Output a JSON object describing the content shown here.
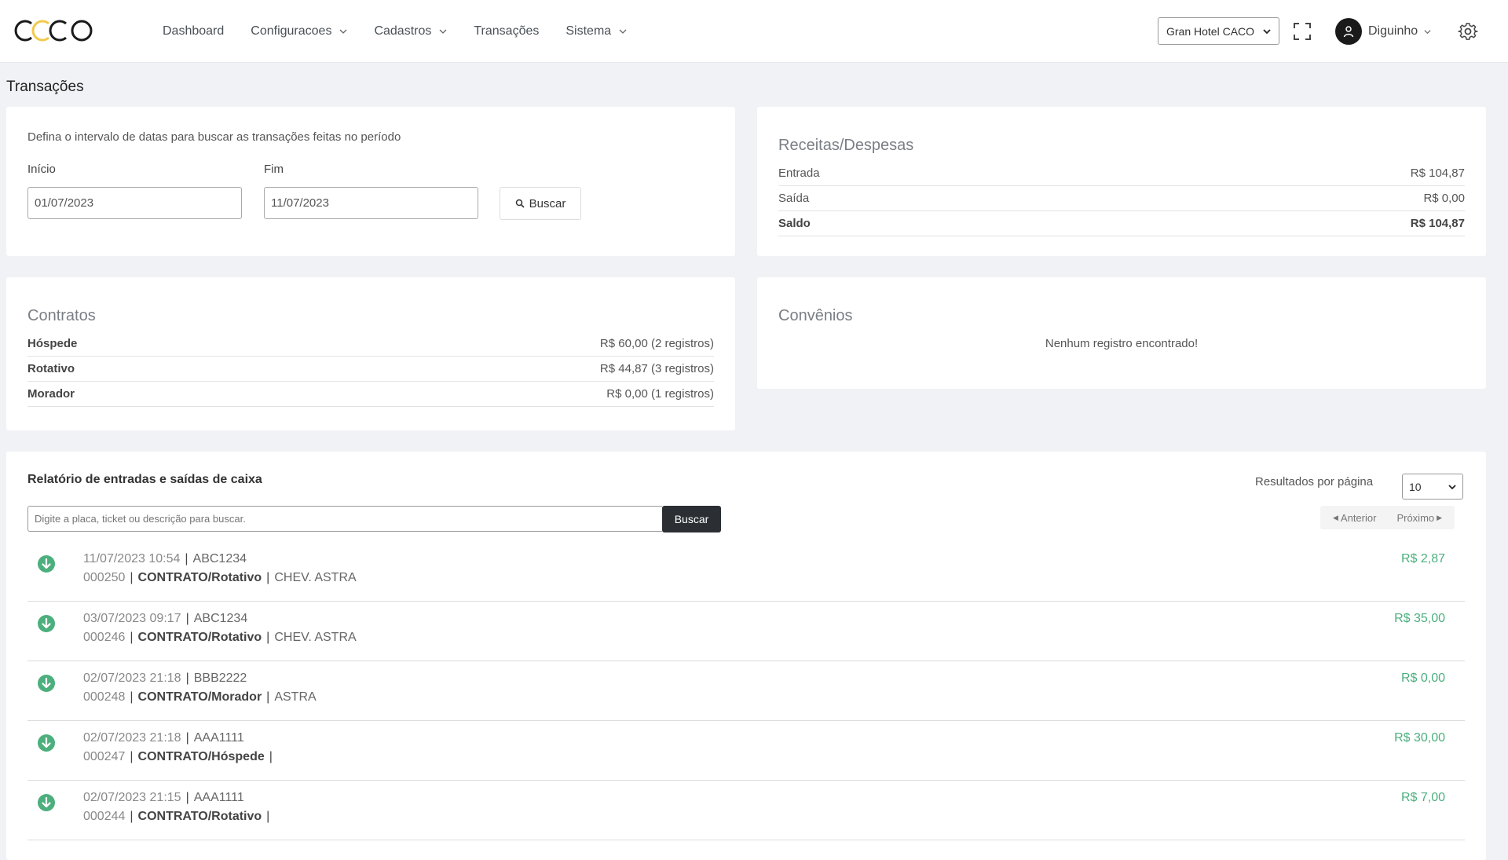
{
  "app": {
    "logo_text": "CACO"
  },
  "nav": {
    "items": [
      {
        "label": "Dashboard",
        "dropdown": false
      },
      {
        "label": "Configuracoes",
        "dropdown": true
      },
      {
        "label": "Cadastros",
        "dropdown": true
      },
      {
        "label": "Transações",
        "dropdown": false
      },
      {
        "label": "Sistema",
        "dropdown": true
      }
    ]
  },
  "header": {
    "hotel_selected": "Gran Hotel CACO",
    "user_name": "Diguinho"
  },
  "page": {
    "title": "Transações"
  },
  "filter": {
    "description": "Defina o intervalo de datas para buscar as transações feitas no período",
    "start_label": "Início",
    "end_label": "Fim",
    "start_value": "01/07/2023",
    "end_value": "11/07/2023",
    "search_label": "Buscar"
  },
  "receitas": {
    "title": "Receitas/Despesas",
    "rows": [
      {
        "label": "Entrada",
        "value": "R$ 104,87"
      },
      {
        "label": "Saída",
        "value": "R$ 0,00"
      },
      {
        "label": "Saldo",
        "value": "R$ 104,87"
      }
    ]
  },
  "contratos": {
    "title": "Contratos",
    "rows": [
      {
        "label": "Hóspede",
        "value": "R$ 60,00 (2 registros)"
      },
      {
        "label": "Rotativo",
        "value": "R$ 44,87 (3 registros)"
      },
      {
        "label": "Morador",
        "value": "R$ 0,00 (1 registros)"
      }
    ]
  },
  "convenios": {
    "title": "Convênios",
    "empty_message": "Nenhum registro encontrado!"
  },
  "relatorio": {
    "title": "Relatório de entradas e saídas de caixa",
    "per_page_label": "Resultados por página",
    "per_page_value": "10",
    "search_placeholder": "Digite a placa, ticket ou descrição para buscar.",
    "search_button": "Buscar",
    "prev_label": "Anterior",
    "next_label": "Próximo",
    "colors": {
      "income": "#4caf7d"
    },
    "transactions": [
      {
        "datetime": "11/07/2023 10:54",
        "plate": "ABC1234",
        "ticket": "000250",
        "type": "CONTRATO/Rotativo",
        "model": "CHEV. ASTRA",
        "amount": "R$ 2,87"
      },
      {
        "datetime": "03/07/2023 09:17",
        "plate": "ABC1234",
        "ticket": "000246",
        "type": "CONTRATO/Rotativo",
        "model": "CHEV. ASTRA",
        "amount": "R$ 35,00"
      },
      {
        "datetime": "02/07/2023 21:18",
        "plate": "BBB2222",
        "ticket": "000248",
        "type": "CONTRATO/Morador",
        "model": "ASTRA",
        "amount": "R$ 0,00"
      },
      {
        "datetime": "02/07/2023 21:18",
        "plate": "AAA1111",
        "ticket": "000247",
        "type": "CONTRATO/Hóspede",
        "model": "",
        "amount": "R$ 30,00"
      },
      {
        "datetime": "02/07/2023 21:15",
        "plate": "AAA1111",
        "ticket": "000244",
        "type": "CONTRATO/Rotativo",
        "model": "",
        "amount": "R$ 7,00"
      }
    ]
  }
}
